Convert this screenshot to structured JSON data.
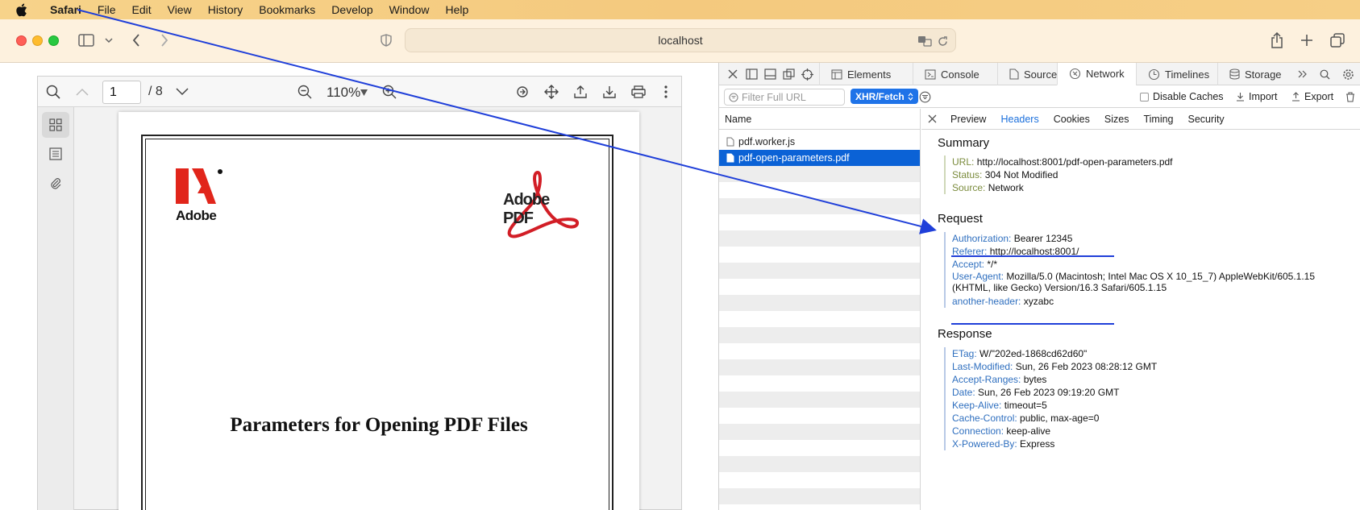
{
  "menubar": {
    "app": "Safari",
    "items": [
      "File",
      "Edit",
      "View",
      "History",
      "Bookmarks",
      "Develop",
      "Window",
      "Help"
    ]
  },
  "toolbar": {
    "address": "localhost"
  },
  "pdf": {
    "page_current": "1",
    "page_total": "/ 8",
    "zoom": "110%",
    "logo_left": "Adobe",
    "logo_right": "Adobe PDF",
    "title": "Parameters for Opening PDF Files"
  },
  "inspector": {
    "tabs": [
      "Elements",
      "Console",
      "Sources",
      "Network",
      "Timelines",
      "Storage"
    ],
    "active_tab": "Network",
    "filter_placeholder": "Filter Full URL",
    "type_filter": "XHR/Fetch",
    "disable_caches": "Disable Caches",
    "import_label": "Import",
    "export_label": "Export",
    "list_header": "Name",
    "requests": [
      "pdf.worker.js",
      "pdf-open-parameters.pdf"
    ],
    "selected_request": "pdf-open-parameters.pdf",
    "detail_tabs": [
      "Preview",
      "Headers",
      "Cookies",
      "Sizes",
      "Timing",
      "Security"
    ],
    "active_detail_tab": "Headers",
    "summary": {
      "title": "Summary",
      "rows": [
        {
          "k": "URL:",
          "v": "http://localhost:8001/pdf-open-parameters.pdf"
        },
        {
          "k": "Status:",
          "v": "304 Not Modified"
        },
        {
          "k": "Source:",
          "v": "Network"
        }
      ]
    },
    "request": {
      "title": "Request",
      "rows": [
        {
          "k": "Authorization:",
          "v": "Bearer 12345"
        },
        {
          "k": "Referer:",
          "v": "http://localhost:8001/"
        },
        {
          "k": "Accept:",
          "v": "*/*"
        },
        {
          "k": "User-Agent:",
          "v": "Mozilla/5.0 (Macintosh; Intel Mac OS X 10_15_7) AppleWebKit/605.1.15 (KHTML, like Gecko) Version/16.3 Safari/605.1.15"
        },
        {
          "k": "another-header:",
          "v": "xyzabc"
        }
      ]
    },
    "response": {
      "title": "Response",
      "rows": [
        {
          "k": "ETag:",
          "v": "W/\"202ed-1868cd62d60\""
        },
        {
          "k": "Last-Modified:",
          "v": "Sun, 26 Feb 2023 08:28:12 GMT"
        },
        {
          "k": "Accept-Ranges:",
          "v": "bytes"
        },
        {
          "k": "Date:",
          "v": "Sun, 26 Feb 2023 09:19:20 GMT"
        },
        {
          "k": "Keep-Alive:",
          "v": "timeout=5"
        },
        {
          "k": "Cache-Control:",
          "v": "public, max-age=0"
        },
        {
          "k": "Connection:",
          "v": "keep-alive"
        },
        {
          "k": "X-Powered-By:",
          "v": "Express"
        }
      ]
    }
  },
  "colors": {
    "selection_blue": "#0b62d6",
    "annotation_blue": "#1f3fd9",
    "request_key_blue": "#2f6fbf",
    "summary_key_green": "#7b8c3d"
  }
}
